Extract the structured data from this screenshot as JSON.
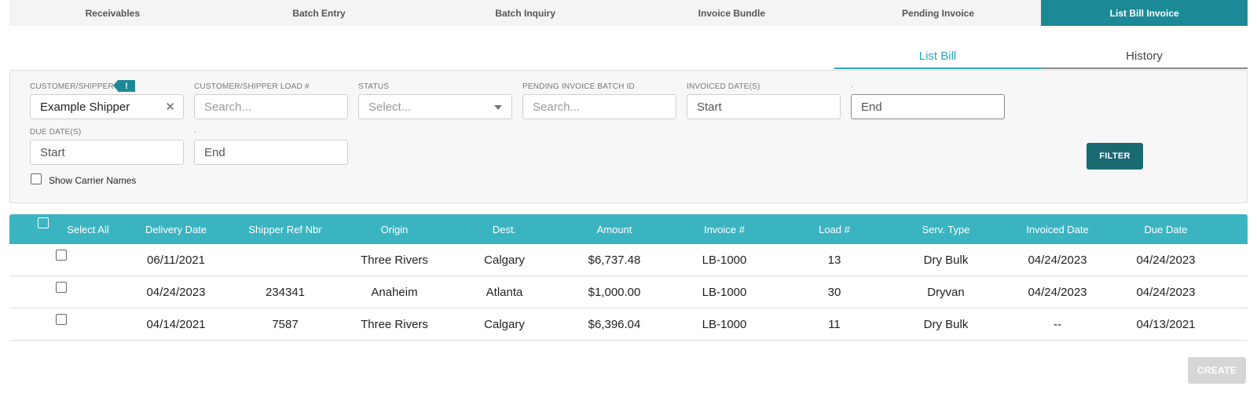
{
  "top_tabs": [
    {
      "label": "Receivables"
    },
    {
      "label": "Batch Entry"
    },
    {
      "label": "Batch Inquiry"
    },
    {
      "label": "Invoice Bundle"
    },
    {
      "label": "Pending Invoice"
    },
    {
      "label": "List Bill Invoice"
    }
  ],
  "sub_tabs": [
    {
      "label": "List Bill"
    },
    {
      "label": "History"
    }
  ],
  "filters": {
    "customer_label": "CUSTOMER/SHIPPER",
    "customer_value": "Example Shipper",
    "warn_badge": "!",
    "load_label": "CUSTOMER/SHIPPER LOAD #",
    "load_placeholder": "Search...",
    "status_label": "STATUS",
    "status_placeholder": "Select...",
    "batch_label": "PENDING INVOICE BATCH ID",
    "batch_placeholder": "Search...",
    "invoiced_label": "INVOICED DATE(S)",
    "invoiced_start": "Start",
    "invoiced_end_label": ".",
    "invoiced_end": "End",
    "due_label": "DUE DATE(S)",
    "due_start": "Start",
    "due_end_label": ".",
    "due_end": "End",
    "show_carrier": "Show Carrier Names",
    "filter_button": "FILTER"
  },
  "table": {
    "select_all": "Select All",
    "headers": [
      "Delivery Date",
      "Shipper Ref Nbr",
      "Origin",
      "Dest.",
      "Amount",
      "Invoice #",
      "Load #",
      "Serv. Type",
      "Invoiced Date",
      "Due Date"
    ],
    "rows": [
      [
        "06/11/2021",
        "",
        "Three Rivers",
        "Calgary",
        "$6,737.48",
        "LB-1000",
        "13",
        "Dry Bulk",
        "04/24/2023",
        "04/24/2023"
      ],
      [
        "04/24/2023",
        "234341",
        "Anaheim",
        "Atlanta",
        "$1,000.00",
        "LB-1000",
        "30",
        "Dryvan",
        "04/24/2023",
        "04/24/2023"
      ],
      [
        "04/14/2021",
        "7587",
        "Three Rivers",
        "Calgary",
        "$6,396.04",
        "LB-1000",
        "11",
        "Dry Bulk",
        "--",
        "04/13/2021"
      ]
    ]
  },
  "create_button": "CREATE"
}
